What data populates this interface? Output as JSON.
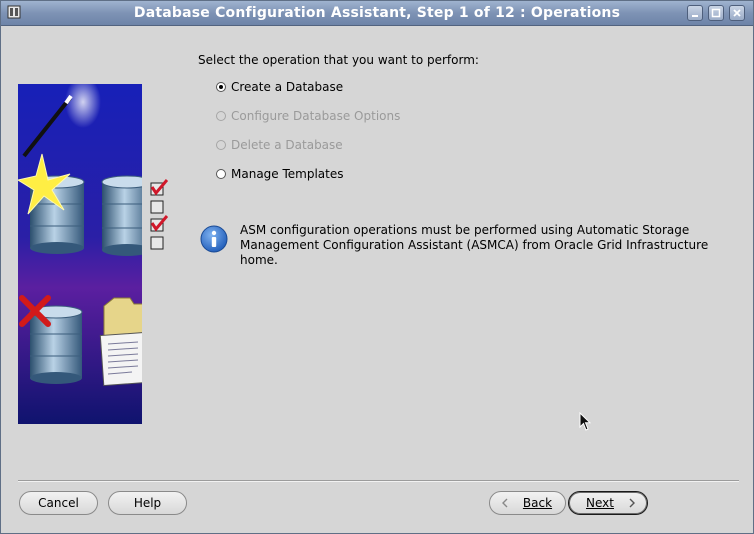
{
  "window": {
    "title": "Database Configuration Assistant, Step 1 of 12 : Operations",
    "controls": [
      "minimize-icon",
      "maximize-icon",
      "close-icon"
    ]
  },
  "main": {
    "prompt": "Select the operation that you want to perform:",
    "options": [
      {
        "label": "Create a Database",
        "selected": true,
        "enabled": true
      },
      {
        "label": "Configure Database Options",
        "selected": false,
        "enabled": false
      },
      {
        "label": "Delete a Database",
        "selected": false,
        "enabled": false
      },
      {
        "label": "Manage Templates",
        "selected": false,
        "enabled": true
      }
    ],
    "info": {
      "line1": "ASM configuration operations must be performed using Automatic Storage",
      "line2": "Management Configuration Assistant (ASMCA) from Oracle Grid Infrastructure home."
    }
  },
  "footer": {
    "cancel_label": "Cancel",
    "help_label": "Help",
    "back_label": "Back",
    "next_label": "Next"
  },
  "colors": {
    "titlebar": "#7e93b5",
    "window_bg": "#d6d6d6",
    "info_icon": "#2f6fc6",
    "art_bg": "#1a1d8a"
  }
}
